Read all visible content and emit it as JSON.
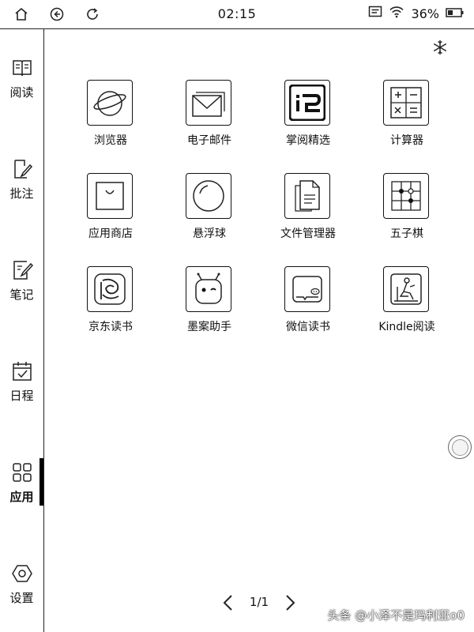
{
  "status": {
    "time": "02:15",
    "battery": "36%",
    "left_icons": [
      "home-icon",
      "back-icon",
      "refresh-icon"
    ],
    "right_icons": [
      "message-icon",
      "wifi-icon",
      "battery-icon"
    ]
  },
  "sidebar": {
    "items": [
      {
        "label": "阅读",
        "icon": "book-icon"
      },
      {
        "label": "批注",
        "icon": "annotate-icon"
      },
      {
        "label": "笔记",
        "icon": "note-icon"
      },
      {
        "label": "日程",
        "icon": "calendar-icon"
      },
      {
        "label": "应用",
        "icon": "apps-icon",
        "active": true
      },
      {
        "label": "设置",
        "icon": "settings-icon"
      }
    ]
  },
  "top_right_icon": "snowflake-icon",
  "apps": [
    {
      "name": "浏览器",
      "icon": "browser-icon"
    },
    {
      "name": "电子邮件",
      "icon": "email-icon"
    },
    {
      "name": "掌阅精选",
      "icon": "ireader-icon"
    },
    {
      "name": "计算器",
      "icon": "calculator-icon"
    },
    {
      "name": "应用商店",
      "icon": "app-store-icon"
    },
    {
      "name": "悬浮球",
      "icon": "floating-ball-icon"
    },
    {
      "name": "文件管理器",
      "icon": "file-manager-icon"
    },
    {
      "name": "五子棋",
      "icon": "gomoku-icon"
    },
    {
      "name": "京东读书",
      "icon": "jd-reading-icon"
    },
    {
      "name": "墨案助手",
      "icon": "moaan-assistant-icon"
    },
    {
      "name": "微信读书",
      "icon": "wechat-reading-icon"
    },
    {
      "name": "Kindle阅读",
      "icon": "kindle-icon"
    }
  ],
  "pager": {
    "text": "1/1"
  },
  "watermark": "头条 @小泽不是玛利亚o0"
}
